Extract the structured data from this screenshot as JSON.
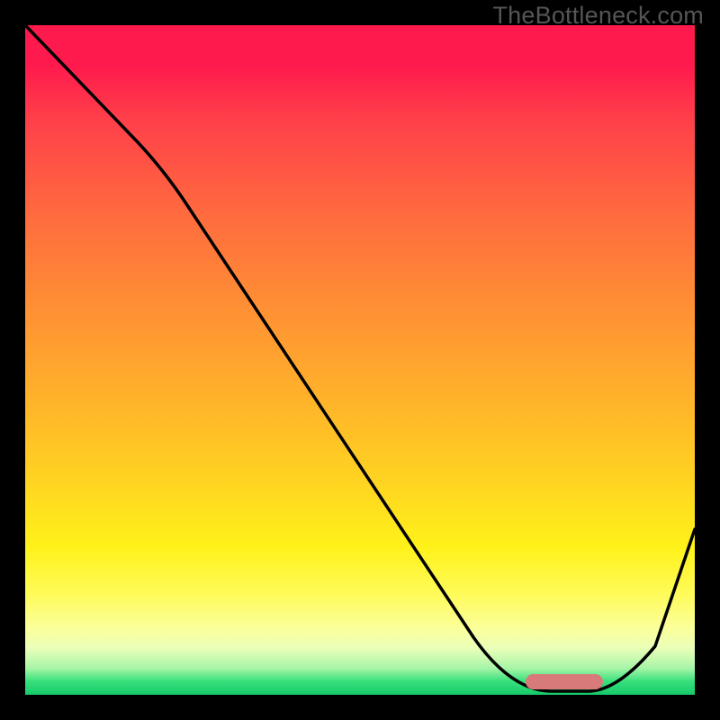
{
  "watermark": "TheBottleneck.com",
  "chart_data": {
    "type": "line",
    "title": "",
    "xlabel": "",
    "ylabel": "",
    "xlim": [
      0,
      100
    ],
    "ylim": [
      0,
      100
    ],
    "x": [
      0,
      12,
      24,
      36,
      48,
      60,
      72,
      78,
      84,
      92,
      100
    ],
    "values": [
      100,
      88,
      78,
      61,
      44,
      27,
      10,
      2,
      0,
      4,
      25
    ],
    "minimum_region": {
      "x_start": 76,
      "x_end": 86,
      "y": 1.5
    },
    "grid": false,
    "legend": false,
    "colors": {
      "curve": "#000000",
      "marker": "#d97a7a",
      "gradient_top": "#ff1a4d",
      "gradient_bottom": "#16c96c"
    }
  }
}
